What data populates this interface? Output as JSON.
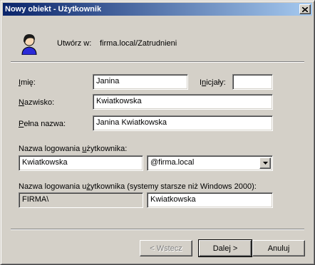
{
  "window": {
    "title": "Nowy obiekt - Użytkownik"
  },
  "header": {
    "create_in_label": "Utwórz w:",
    "create_in_value": "firma.local/Zatrudnieni"
  },
  "form": {
    "first_name_label": "Imię:",
    "first_name": "Janina",
    "initials_label": "Inicjały:",
    "initials": "",
    "last_name_label": "Nazwisko:",
    "last_name": "Kwiatkowska",
    "full_name_label": "Pełna nazwa:",
    "full_name": "Janina Kwiatkowska",
    "logon_label": "Nazwa logowania użytkownika:",
    "logon_name": "Kwiatkowska",
    "upn_suffix": "@firma.local",
    "legacy_label": "Nazwa logowania użytkownika (systemy starsze niż Windows 2000):",
    "legacy_domain": "FIRMA\\",
    "legacy_name": "Kwiatkowska"
  },
  "buttons": {
    "back": "< Wstecz",
    "next": "Dalej >",
    "cancel": "Anuluj"
  },
  "icons": {
    "user_icon": "user-icon",
    "close_icon": "close-icon",
    "dropdown_icon": "chevron-down-icon"
  },
  "colors": {
    "titlebar_start": "#0a246a",
    "titlebar_end": "#a6caf0",
    "dialog_bg": "#d4d0c8"
  }
}
